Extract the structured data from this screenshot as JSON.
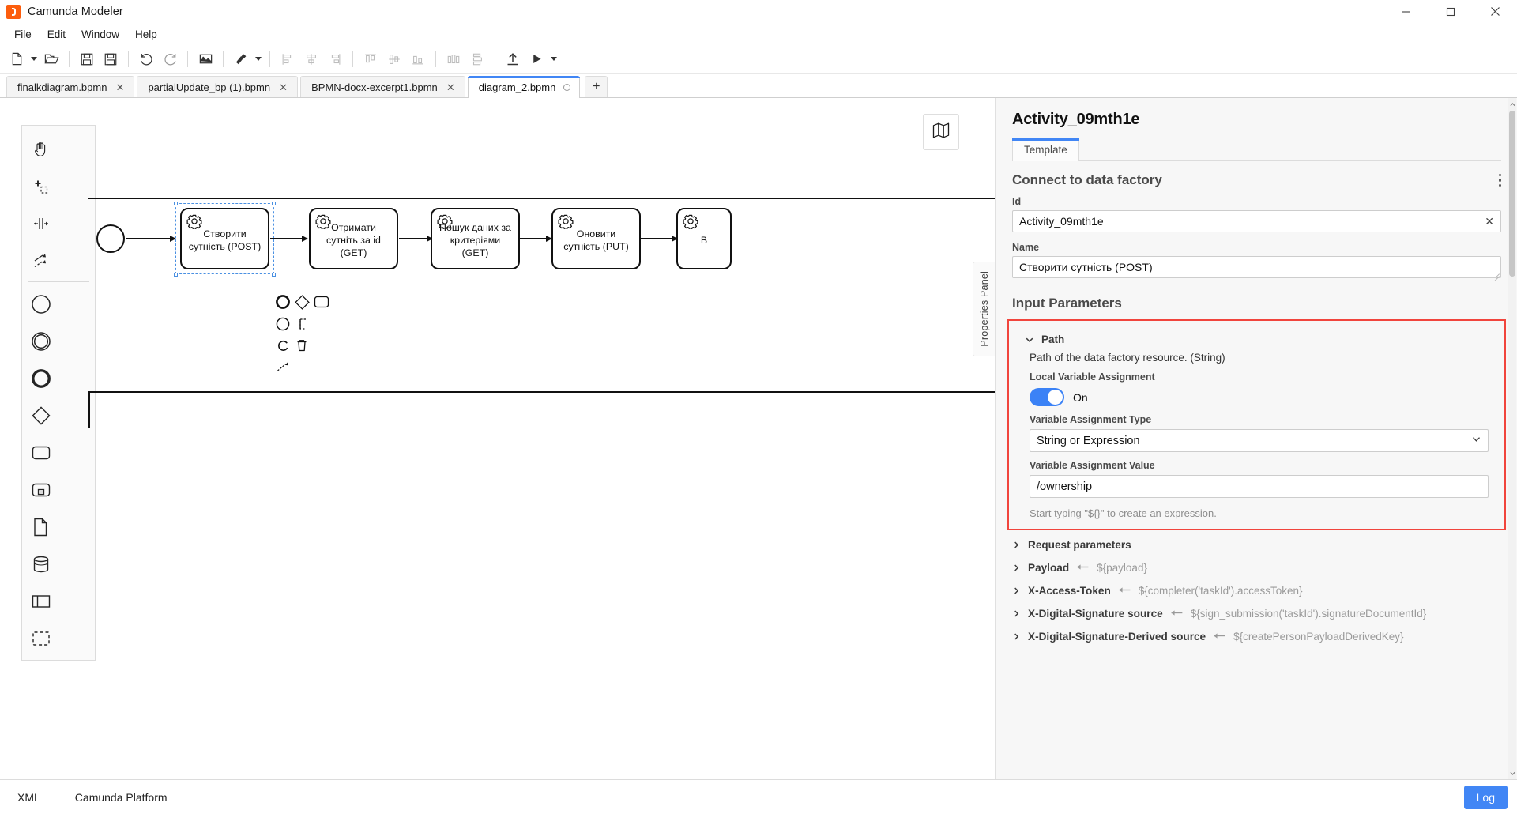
{
  "window": {
    "title": "Camunda Modeler",
    "logo_icon": "camunda-logo-icon",
    "minimize_icon": "minimize-icon",
    "maximize_icon": "maximize-icon",
    "close_icon": "close-icon"
  },
  "menu": {
    "items": [
      {
        "label": "File"
      },
      {
        "label": "Edit"
      },
      {
        "label": "Window"
      },
      {
        "label": "Help"
      }
    ]
  },
  "toolbar": {
    "buttons": [
      {
        "name": "new-diagram-button",
        "icon": "file-icon"
      },
      {
        "name": "new-diagram-dropdown",
        "icon": "caret-down-icon"
      },
      {
        "name": "open-file-button",
        "icon": "folder-open-icon"
      },
      {
        "name": "save-button",
        "icon": "save-icon"
      },
      {
        "name": "save-as-button",
        "icon": "save-as-icon"
      },
      {
        "name": "undo-button",
        "icon": "undo-icon"
      },
      {
        "name": "redo-button",
        "icon": "redo-icon"
      },
      {
        "name": "export-image-button",
        "icon": "image-icon"
      },
      {
        "name": "align-tools-button",
        "icon": "brush-icon"
      },
      {
        "name": "align-tools-dropdown",
        "icon": "caret-down-icon"
      },
      {
        "name": "align-left-button",
        "icon": "align-left-icon"
      },
      {
        "name": "align-center-horizontal-button",
        "icon": "align-center-h-icon"
      },
      {
        "name": "align-right-button",
        "icon": "align-right-icon"
      },
      {
        "name": "align-top-button",
        "icon": "align-top-icon"
      },
      {
        "name": "align-middle-button",
        "icon": "align-middle-icon"
      },
      {
        "name": "align-bottom-button",
        "icon": "align-bottom-icon"
      },
      {
        "name": "distribute-horizontal-button",
        "icon": "distribute-h-icon"
      },
      {
        "name": "distribute-vertical-button",
        "icon": "distribute-v-icon"
      },
      {
        "name": "deploy-button",
        "icon": "upload-icon"
      },
      {
        "name": "run-button",
        "icon": "play-icon"
      },
      {
        "name": "run-dropdown",
        "icon": "caret-down-icon"
      }
    ]
  },
  "tabs": {
    "items": [
      {
        "label": "finalkdiagram.bpmn",
        "active": false,
        "dirty": false
      },
      {
        "label": "partialUpdate_bp (1).bpmn",
        "active": false,
        "dirty": false
      },
      {
        "label": "BPMN-docx-excerpt1.bpmn",
        "active": false,
        "dirty": false
      },
      {
        "label": "diagram_2.bpmn",
        "active": true,
        "dirty": true
      }
    ],
    "add_label": "+"
  },
  "canvas": {
    "minimap_icon": "map-icon",
    "properties_panel_tab_label": "Properties Panel",
    "palette": [
      {
        "name": "hand-tool",
        "icon": "hand-icon"
      },
      {
        "name": "lasso-tool",
        "icon": "lasso-icon"
      },
      {
        "name": "space-tool",
        "icon": "space-tool-icon"
      },
      {
        "name": "global-connect-tool",
        "icon": "connect-icon"
      },
      {
        "name": "create-start-event",
        "icon": "circle-icon"
      },
      {
        "name": "create-intermediate-event",
        "icon": "double-circle-icon"
      },
      {
        "name": "create-end-event",
        "icon": "thick-circle-icon"
      },
      {
        "name": "create-gateway",
        "icon": "diamond-icon"
      },
      {
        "name": "create-task",
        "icon": "rounded-rect-icon"
      },
      {
        "name": "create-subprocess",
        "icon": "subprocess-icon"
      },
      {
        "name": "create-data-object",
        "icon": "document-icon"
      },
      {
        "name": "create-data-store",
        "icon": "database-icon"
      },
      {
        "name": "create-participant",
        "icon": "pool-icon"
      },
      {
        "name": "create-group",
        "icon": "group-icon"
      }
    ],
    "tasks": [
      {
        "label": "Створити сутність (POST)",
        "selected": true
      },
      {
        "label": "Отримати сутніть за id (GET)",
        "selected": false
      },
      {
        "label": "Пошук даних за критеріями (GET)",
        "selected": false
      },
      {
        "label": "Оновити сутність (PUT)",
        "selected": false
      },
      {
        "label": "В",
        "selected": false
      }
    ],
    "context_pad": [
      {
        "name": "append-end-event-action",
        "icon": "thick-circle-icon"
      },
      {
        "name": "append-gateway-action",
        "icon": "diamond-icon"
      },
      {
        "name": "append-task-action",
        "icon": "rounded-rect-icon"
      },
      {
        "name": "append-intermediate-event-action",
        "icon": "circle-icon"
      },
      {
        "name": "append-text-annotation-action",
        "icon": "annotation-icon"
      },
      {
        "name": "replace-action",
        "icon": "wrench-icon"
      },
      {
        "name": "delete-action",
        "icon": "trash-icon"
      },
      {
        "name": "connect-action",
        "icon": "connect-icon"
      }
    ]
  },
  "properties": {
    "element_id": "Activity_09mth1e",
    "tabs": [
      {
        "label": "Template",
        "active": true
      }
    ],
    "template_group": {
      "title": "Connect to data factory",
      "menu_icon": "kebab-menu-icon"
    },
    "id_field": {
      "label": "Id",
      "value": "Activity_09mth1e",
      "clear_icon": "clear-icon"
    },
    "name_field": {
      "label": "Name",
      "value": "Створити сутність (POST)"
    },
    "input_parameters": {
      "title": "Input Parameters",
      "expanded_item": {
        "name": "Path",
        "chevron_icon": "chevron-down-icon",
        "description": "Path of the data factory resource. (String)",
        "local_variable_assignment": {
          "label": "Local Variable Assignment",
          "state": "On",
          "toggle_on": true,
          "accent_color": "#3b82f6"
        },
        "variable_assignment_type": {
          "label": "Variable Assignment Type",
          "value": "String or Expression",
          "caret_icon": "chevron-down-icon"
        },
        "variable_assignment_value": {
          "label": "Variable Assignment Value",
          "value": "/ownership",
          "hint": "Start typing \"${}\" to create an expression."
        }
      },
      "highlight_color": "#f1453d",
      "collapsed_items": [
        {
          "name": "Request parameters",
          "chevron_icon": "chevron-right-icon",
          "assignment": ""
        },
        {
          "name": "Payload",
          "chevron_icon": "chevron-right-icon",
          "arrow_icon": "arrow-left-icon",
          "assignment": "${payload}"
        },
        {
          "name": "X-Access-Token",
          "chevron_icon": "chevron-right-icon",
          "arrow_icon": "arrow-left-icon",
          "assignment": "${completer('taskId').accessToken}"
        },
        {
          "name": "X-Digital-Signature source",
          "chevron_icon": "chevron-right-icon",
          "arrow_icon": "arrow-left-icon",
          "assignment": "${sign_submission('taskId').signatureDocumentId}"
        },
        {
          "name": "X-Digital-Signature-Derived source",
          "chevron_icon": "chevron-right-icon",
          "arrow_icon": "arrow-left-icon",
          "assignment": "${createPersonPayloadDerivedKey}"
        }
      ]
    }
  },
  "statusbar": {
    "items": [
      {
        "label": "XML",
        "name": "xml-tab-button"
      },
      {
        "label": "Camunda Platform",
        "name": "engine-profile-button"
      }
    ],
    "log_label": "Log",
    "log_color": "#4186f5"
  }
}
